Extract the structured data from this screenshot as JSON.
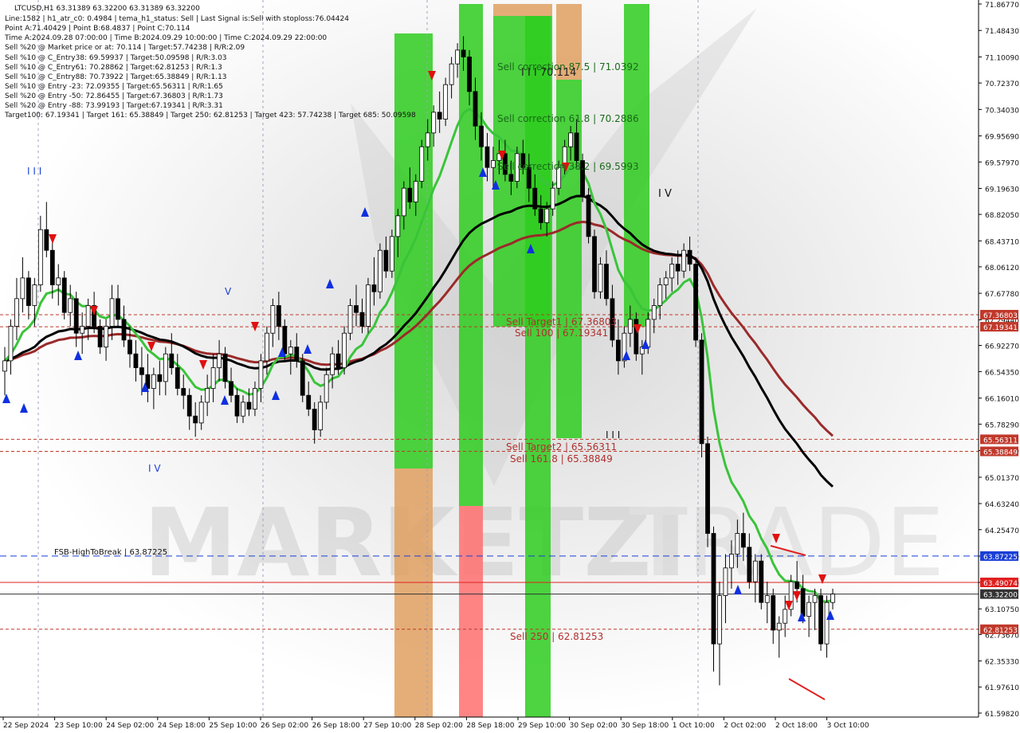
{
  "header": {
    "lines": [
      "LTCUSD,H1  63.31389 63.32200 63.31389 63.32200",
      "Line:1582 | h1_atr_c0: 0.4984 | tema_h1_status: Sell | Last Signal is:Sell with stoploss:76.04424",
      "Point A:71.40429 | Point B:68.4837 | Point C:70.114",
      "Time A:2024.09.28 07:00:00 | Time B:2024.09.29 10:00:00 | Time C:2024.09.29 22:00:00",
      "Sell %20 @ Market price or at: 70.114 | Target:57.74238 | R/R:2.09",
      "Sell %10 @ C_Entry38: 69.59937 | Target:50.09598 | R/R:3.03",
      "Sell %10 @ C_Entry61: 70.28862 | Target:62.81253 | R/R:1.3",
      "Sell %10 @ C_Entry88: 70.73922 | Target:65.38849 | R/R:1.13",
      "Sell %10 @ Entry -23: 72.09355 | Target:65.56311 | R/R:1.65",
      "Sell %20 @ Entry -50: 72.86455 | Target:67.36803 | R/R:1.73",
      "Sell %20 @ Entry -88: 73.99193 | Target:67.19341 | R/R:3.31",
      "Target100: 67.19341 | Target 161: 65.38849 | Target 250: 62.81253 | Target 423: 57.74238 | Target 685: 50.09598"
    ]
  },
  "chart_data": {
    "type": "candlestick",
    "symbol": "LTCUSD",
    "timeframe": "H1",
    "ylim": [
      61.5982,
      71.8677
    ],
    "y_ticks": [
      "71.86770",
      "71.48430",
      "71.10090",
      "70.72370",
      "70.34030",
      "69.95690",
      "69.57970",
      "69.19630",
      "68.82050",
      "68.43710",
      "68.06120",
      "67.67780",
      "67.29440",
      "66.92270",
      "66.54350",
      "66.16010",
      "65.78290",
      "65.39950",
      "65.01370",
      "64.63240",
      "64.25470",
      "63.87130",
      "63.49070",
      "63.10750",
      "62.73670",
      "62.35330",
      "61.97610",
      "61.59820"
    ],
    "x_ticks": [
      "22 Sep 2024",
      "23 Sep 10:00",
      "24 Sep 02:00",
      "24 Sep 18:00",
      "25 Sep 10:00",
      "26 Sep 02:00",
      "26 Sep 18:00",
      "27 Sep 10:00",
      "28 Sep 02:00",
      "28 Sep 18:00",
      "29 Sep 10:00",
      "30 Sep 02:00",
      "30 Sep 18:00",
      "1 Oct 10:00",
      "2 Oct 02:00",
      "2 Oct 18:00",
      "3 Oct 10:00"
    ],
    "price_tags": [
      {
        "label": "67.36803",
        "value": 67.36803,
        "color": "#c0392b"
      },
      {
        "label": "67.19341",
        "value": 67.19341,
        "color": "#c0392b"
      },
      {
        "label": "65.56311",
        "value": 65.56311,
        "color": "#c0392b"
      },
      {
        "label": "65.38849",
        "value": 65.38849,
        "color": "#c0392b"
      },
      {
        "label": "63.87225",
        "value": 63.87225,
        "color": "#1a3fd6"
      },
      {
        "label": "63.49074",
        "value": 63.49074,
        "color": "#e02020"
      },
      {
        "label": "63.32200",
        "value": 63.322,
        "color": "#333333"
      },
      {
        "label": "62.81253",
        "value": 62.81253,
        "color": "#c0392b"
      }
    ],
    "levels": [
      {
        "text": "Sell Target1 | 67.36803",
        "value": 67.36803
      },
      {
        "text": "Sell 100 | 67.19341",
        "value": 67.19341
      },
      {
        "text": "Sell Target2 | 65.56311",
        "value": 65.56311
      },
      {
        "text": "Sell 161.8 | 65.38849",
        "value": 65.38849
      },
      {
        "text": "Sell  250 | 62.81253",
        "value": 62.81253
      }
    ],
    "corrections": [
      {
        "text": "Sell correction 87.5 | 71.0392",
        "value": 71.0392
      },
      {
        "text": "Sell correction 61.8 | 70.2886",
        "value": 70.2886
      },
      {
        "text": "Sell correction 38.2 | 69.5993",
        "value": 69.5993
      }
    ],
    "fsb": {
      "text": "FSB-HighToBreak | 63.87225",
      "value": 63.87225
    },
    "point_c_text": "I I I 70.114",
    "wave_labels": [
      "I I I",
      "V",
      "I V",
      "I V",
      "I I I"
    ],
    "colors": {
      "green": "#2ecc1f",
      "orange": "#e0a060",
      "red": "#ff7070",
      "ma_green": "#3ac43a",
      "ma_black": "#000000",
      "ma_brown": "#9b2a2a"
    },
    "ohlc": [
      [
        66.55,
        66.9,
        66.2,
        66.7
      ],
      [
        66.7,
        67.3,
        66.5,
        67.2
      ],
      [
        67.2,
        67.9,
        67.0,
        67.6
      ],
      [
        67.6,
        68.2,
        67.4,
        67.9
      ],
      [
        67.9,
        68.0,
        67.3,
        67.5
      ],
      [
        67.5,
        67.9,
        67.2,
        67.8
      ],
      [
        67.8,
        68.8,
        67.7,
        68.6
      ],
      [
        68.6,
        69.0,
        68.2,
        68.3
      ],
      [
        68.3,
        68.5,
        67.6,
        67.8
      ],
      [
        67.8,
        68.1,
        67.5,
        67.9
      ],
      [
        67.9,
        68.0,
        67.3,
        67.4
      ],
      [
        67.4,
        67.8,
        67.2,
        67.6
      ],
      [
        67.6,
        67.7,
        66.9,
        67.1
      ],
      [
        67.1,
        67.4,
        66.8,
        67.2
      ],
      [
        67.2,
        67.6,
        67.0,
        67.5
      ],
      [
        67.5,
        67.7,
        67.1,
        67.2
      ],
      [
        67.2,
        67.3,
        66.8,
        66.9
      ],
      [
        66.9,
        67.3,
        66.7,
        67.2
      ],
      [
        67.2,
        67.8,
        67.0,
        67.6
      ],
      [
        67.6,
        67.8,
        67.2,
        67.3
      ],
      [
        67.3,
        67.5,
        66.9,
        67.0
      ],
      [
        67.0,
        67.2,
        66.6,
        66.8
      ],
      [
        66.8,
        67.0,
        66.4,
        66.6
      ],
      [
        66.6,
        66.9,
        66.2,
        66.5
      ],
      [
        66.5,
        66.8,
        66.1,
        66.3
      ],
      [
        66.3,
        66.6,
        66.0,
        66.5
      ],
      [
        66.5,
        66.7,
        66.2,
        66.4
      ],
      [
        66.4,
        66.9,
        66.2,
        66.8
      ],
      [
        66.8,
        67.1,
        66.5,
        66.6
      ],
      [
        66.6,
        66.8,
        66.2,
        66.3
      ],
      [
        66.3,
        66.5,
        66.0,
        66.2
      ],
      [
        66.2,
        66.3,
        65.7,
        65.9
      ],
      [
        65.9,
        66.1,
        65.6,
        65.8
      ],
      [
        65.8,
        66.2,
        65.7,
        66.1
      ],
      [
        66.1,
        66.5,
        65.9,
        66.3
      ],
      [
        66.3,
        66.8,
        66.1,
        66.6
      ],
      [
        66.6,
        67.0,
        66.4,
        66.8
      ],
      [
        66.8,
        66.9,
        66.3,
        66.4
      ],
      [
        66.4,
        66.6,
        66.1,
        66.2
      ],
      [
        66.2,
        66.3,
        65.8,
        65.9
      ],
      [
        65.9,
        66.2,
        65.8,
        66.1
      ],
      [
        66.1,
        66.3,
        65.9,
        66.0
      ],
      [
        66.0,
        66.4,
        65.9,
        66.3
      ],
      [
        66.3,
        66.8,
        66.1,
        66.7
      ],
      [
        66.7,
        67.2,
        66.5,
        67.1
      ],
      [
        67.1,
        67.6,
        66.9,
        67.5
      ],
      [
        67.5,
        67.7,
        67.0,
        67.2
      ],
      [
        67.2,
        67.3,
        66.7,
        66.8
      ],
      [
        66.8,
        67.0,
        66.5,
        66.9
      ],
      [
        66.9,
        67.1,
        66.6,
        66.7
      ],
      [
        66.7,
        66.8,
        66.1,
        66.2
      ],
      [
        66.2,
        66.4,
        65.9,
        66.0
      ],
      [
        66.0,
        66.1,
        65.5,
        65.7
      ],
      [
        65.7,
        66.2,
        65.6,
        66.1
      ],
      [
        66.1,
        66.6,
        66.0,
        66.5
      ],
      [
        66.5,
        66.9,
        66.3,
        66.8
      ],
      [
        66.8,
        67.0,
        66.5,
        66.6
      ],
      [
        66.6,
        67.2,
        66.5,
        67.1
      ],
      [
        67.1,
        67.6,
        67.0,
        67.5
      ],
      [
        67.5,
        67.8,
        67.2,
        67.4
      ],
      [
        67.4,
        67.6,
        67.1,
        67.2
      ],
      [
        67.2,
        67.9,
        67.1,
        67.8
      ],
      [
        67.8,
        68.2,
        67.5,
        67.7
      ],
      [
        67.7,
        68.4,
        67.6,
        68.3
      ],
      [
        68.3,
        68.5,
        67.9,
        68.0
      ],
      [
        68.0,
        68.6,
        67.9,
        68.5
      ],
      [
        68.5,
        68.9,
        68.2,
        68.8
      ],
      [
        68.8,
        69.3,
        68.6,
        69.2
      ],
      [
        69.2,
        69.5,
        68.9,
        69.0
      ],
      [
        69.0,
        69.4,
        68.8,
        69.3
      ],
      [
        69.3,
        69.9,
        69.2,
        69.8
      ],
      [
        69.8,
        70.2,
        69.6,
        70.0
      ],
      [
        70.0,
        70.4,
        69.8,
        70.3
      ],
      [
        70.3,
        70.6,
        70.0,
        70.2
      ],
      [
        70.2,
        70.8,
        70.1,
        70.7
      ],
      [
        70.7,
        71.1,
        70.5,
        71.0
      ],
      [
        71.0,
        71.3,
        70.8,
        71.2
      ],
      [
        71.2,
        71.4,
        70.9,
        71.1
      ],
      [
        71.1,
        71.2,
        70.4,
        70.6
      ],
      [
        70.6,
        70.8,
        69.9,
        70.1
      ],
      [
        70.1,
        70.3,
        69.6,
        69.8
      ],
      [
        69.8,
        70.0,
        69.3,
        69.5
      ],
      [
        69.5,
        69.8,
        69.2,
        69.6
      ],
      [
        69.6,
        69.9,
        69.4,
        69.7
      ],
      [
        69.7,
        69.9,
        69.3,
        69.4
      ],
      [
        69.4,
        69.6,
        69.1,
        69.3
      ],
      [
        69.3,
        69.8,
        69.2,
        69.7
      ],
      [
        69.7,
        69.9,
        69.4,
        69.5
      ],
      [
        69.5,
        69.7,
        69.0,
        69.2
      ],
      [
        69.2,
        69.4,
        68.8,
        68.9
      ],
      [
        68.9,
        69.1,
        68.6,
        68.7
      ],
      [
        68.7,
        69.0,
        68.5,
        68.9
      ],
      [
        68.9,
        69.3,
        68.8,
        69.2
      ],
      [
        69.2,
        69.6,
        69.1,
        69.5
      ],
      [
        69.5,
        69.9,
        69.4,
        69.8
      ],
      [
        69.8,
        70.1,
        69.6,
        70.0
      ],
      [
        70.0,
        70.2,
        69.5,
        69.6
      ],
      [
        69.6,
        69.7,
        69.0,
        69.1
      ],
      [
        69.1,
        69.2,
        68.4,
        68.5
      ],
      [
        68.5,
        68.6,
        67.6,
        67.7
      ],
      [
        67.7,
        68.2,
        67.6,
        68.1
      ],
      [
        68.1,
        68.3,
        67.5,
        67.6
      ],
      [
        67.6,
        67.8,
        66.9,
        67.0
      ],
      [
        67.0,
        67.3,
        66.5,
        66.7
      ],
      [
        66.7,
        67.2,
        66.6,
        67.1
      ],
      [
        67.1,
        67.5,
        66.9,
        67.3
      ],
      [
        67.3,
        67.4,
        66.7,
        66.8
      ],
      [
        66.8,
        67.0,
        66.5,
        66.9
      ],
      [
        66.9,
        67.4,
        66.8,
        67.3
      ],
      [
        67.3,
        67.6,
        67.1,
        67.5
      ],
      [
        67.5,
        67.9,
        67.3,
        67.8
      ],
      [
        67.8,
        68.0,
        67.6,
        67.9
      ],
      [
        67.9,
        68.2,
        67.7,
        68.1
      ],
      [
        68.1,
        68.3,
        67.8,
        68.0
      ],
      [
        68.0,
        68.4,
        67.9,
        68.3
      ],
      [
        68.3,
        68.5,
        68.0,
        68.1
      ],
      [
        68.1,
        68.2,
        66.9,
        67.0
      ],
      [
        67.0,
        67.1,
        65.3,
        65.5
      ],
      [
        65.5,
        65.6,
        64.0,
        64.2
      ],
      [
        64.2,
        64.3,
        62.2,
        62.6
      ],
      [
        62.6,
        63.5,
        62.0,
        63.3
      ],
      [
        63.3,
        63.9,
        62.9,
        63.7
      ],
      [
        63.7,
        64.1,
        63.4,
        63.9
      ],
      [
        63.9,
        64.4,
        63.7,
        64.2
      ],
      [
        64.2,
        64.5,
        63.8,
        64.0
      ],
      [
        64.0,
        64.2,
        63.4,
        63.5
      ],
      [
        63.5,
        63.9,
        63.2,
        63.8
      ],
      [
        63.8,
        63.9,
        63.1,
        63.2
      ],
      [
        63.2,
        63.5,
        62.9,
        63.3
      ],
      [
        63.3,
        63.4,
        62.6,
        62.8
      ],
      [
        62.8,
        63.0,
        62.4,
        62.9
      ],
      [
        62.9,
        63.3,
        62.7,
        63.1
      ],
      [
        63.1,
        63.6,
        63.0,
        63.5
      ],
      [
        63.5,
        63.8,
        63.2,
        63.4
      ],
      [
        63.4,
        63.6,
        62.9,
        63.0
      ],
      [
        63.0,
        63.3,
        62.7,
        63.2
      ],
      [
        63.2,
        63.4,
        62.8,
        63.3
      ],
      [
        63.3,
        63.4,
        62.5,
        62.6
      ],
      [
        62.6,
        63.3,
        62.4,
        63.2
      ],
      [
        63.2,
        63.4,
        63.1,
        63.322
      ]
    ]
  }
}
